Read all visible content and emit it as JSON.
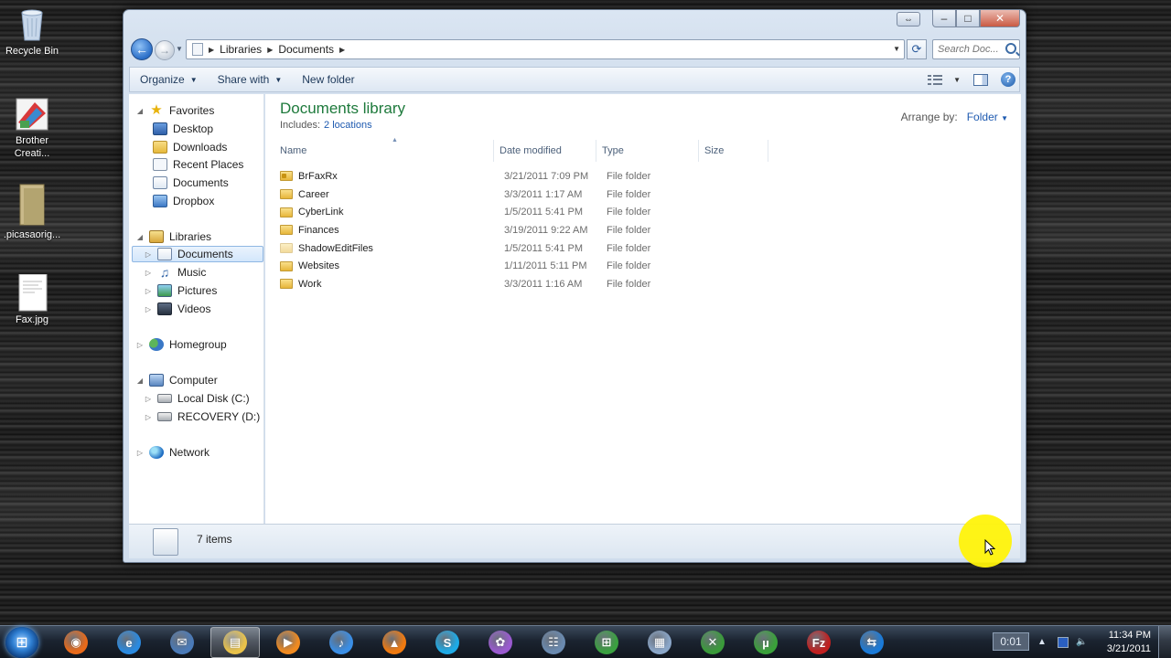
{
  "desktop": {
    "icons": [
      {
        "label": "Recycle Bin",
        "icon": "recycle-bin-icon"
      },
      {
        "label": "Brother\nCreati...",
        "icon": "brother-app-icon"
      },
      {
        "label": ".picasaorig...",
        "icon": "folder-icon"
      },
      {
        "label": "Fax.jpg",
        "icon": "image-file-icon"
      }
    ]
  },
  "window": {
    "caption": {
      "minimize": "‒",
      "maximize": "□",
      "close": "✕",
      "restore": "⇔"
    },
    "address": {
      "crumbs": [
        "Libraries",
        "Documents"
      ],
      "search_placeholder": "Search Doc..."
    },
    "commands": {
      "organize": "Organize",
      "share_with": "Share with",
      "new_folder": "New folder"
    },
    "nav_pane": {
      "favorites": {
        "label": "Favorites",
        "items": [
          "Desktop",
          "Downloads",
          "Recent Places",
          "Documents",
          "Dropbox"
        ]
      },
      "libraries": {
        "label": "Libraries",
        "items": [
          "Documents",
          "Music",
          "Pictures",
          "Videos"
        ]
      },
      "homegroup": "Homegroup",
      "computer": {
        "label": "Computer",
        "items": [
          "Local Disk (C:)",
          "RECOVERY (D:)"
        ]
      },
      "network": "Network"
    },
    "library": {
      "title": "Documents library",
      "includes_label": "Includes:",
      "includes_link": "2 locations",
      "arrange_label": "Arrange by:",
      "arrange_value": "Folder"
    },
    "columns": [
      "Name",
      "Date modified",
      "Type",
      "Size"
    ],
    "files": [
      {
        "name": "BrFaxRx",
        "date": "3/21/2011 7:09 PM",
        "type": "File folder"
      },
      {
        "name": "Career",
        "date": "3/3/2011 1:17 AM",
        "type": "File folder"
      },
      {
        "name": "CyberLink",
        "date": "1/5/2011 5:41 PM",
        "type": "File folder"
      },
      {
        "name": "Finances",
        "date": "3/19/2011 9:22 AM",
        "type": "File folder"
      },
      {
        "name": "ShadowEditFiles",
        "date": "1/5/2011 5:41 PM",
        "type": "File folder"
      },
      {
        "name": "Websites",
        "date": "1/11/2011 5:11 PM",
        "type": "File folder"
      },
      {
        "name": "Work",
        "date": "3/3/2011 1:16 AM",
        "type": "File folder"
      }
    ],
    "status": {
      "item_count": "7 items"
    }
  },
  "taskbar": {
    "apps": [
      {
        "name": "firefox-icon",
        "color": "#e86a1a",
        "glyph": "◉"
      },
      {
        "name": "internet-explorer-icon",
        "color": "#2a8ae0",
        "glyph": "e"
      },
      {
        "name": "thunderbird-icon",
        "color": "#4a7ab8",
        "glyph": "✉"
      },
      {
        "name": "windows-explorer-icon",
        "color": "#e9c24a",
        "glyph": "▤"
      },
      {
        "name": "media-player-icon",
        "color": "#f08a20",
        "glyph": "▶"
      },
      {
        "name": "itunes-icon",
        "color": "#3a8ee6",
        "glyph": "♪"
      },
      {
        "name": "vlc-icon",
        "color": "#f07a10",
        "glyph": "▲"
      },
      {
        "name": "skype-icon",
        "color": "#1eaae6",
        "glyph": "S"
      },
      {
        "name": "picasa-icon",
        "color": "#9a5ad0",
        "glyph": "✿"
      },
      {
        "name": "network-map-icon",
        "color": "#6a8ab0",
        "glyph": "☷"
      },
      {
        "name": "windows-logo-icon",
        "color": "#3aa040",
        "glyph": "⊞"
      },
      {
        "name": "calculator-icon",
        "color": "#8aa6c8",
        "glyph": "▦"
      },
      {
        "name": "xmarks-icon",
        "color": "#3a9a3a",
        "glyph": "✕"
      },
      {
        "name": "utorrent-icon",
        "color": "#3aa03a",
        "glyph": "µ"
      },
      {
        "name": "filezilla-icon",
        "color": "#c02020",
        "glyph": "Fz"
      },
      {
        "name": "teamviewer-icon",
        "color": "#1a7ad8",
        "glyph": "⇆"
      }
    ],
    "tray_timer": "0:01",
    "clock_time": "11:34 PM",
    "clock_date": "3/21/2011"
  }
}
